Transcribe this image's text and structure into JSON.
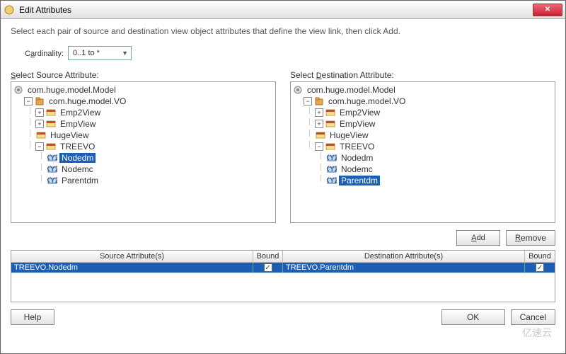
{
  "title": "Edit Attributes",
  "instruction": "Select each pair of source and destination view object attributes that define the view link, then click Add.",
  "cardinality": {
    "label_pre": "C",
    "label_u": "a",
    "label_post": "rdinality:",
    "value": "0..1 to *"
  },
  "source_pane": {
    "label": "Select Source Attribute:"
  },
  "dest_pane": {
    "label": "Select Destination Attribute:"
  },
  "tree_root": "com.huge.model.Model",
  "tree_pkg": "com.huge.model.VO",
  "tree_views": [
    "Emp2View",
    "EmpView",
    "HugeView",
    "TREEVO"
  ],
  "tree_attrs": [
    "Nodedm",
    "Nodemc",
    "Parentdm"
  ],
  "source_selected": "Nodedm",
  "dest_selected": "Parentdm",
  "buttons": {
    "add": "Add",
    "remove": "Remove",
    "help": "Help",
    "ok": "OK",
    "cancel": "Cancel"
  },
  "table": {
    "head_src": "Source Attribute(s)",
    "head_bound": "Bound",
    "head_dst": "Destination Attribute(s)",
    "row_src": "TREEVO.Nodedm",
    "row_dst": "TREEVO.Parentdm"
  },
  "watermark": "亿速云"
}
